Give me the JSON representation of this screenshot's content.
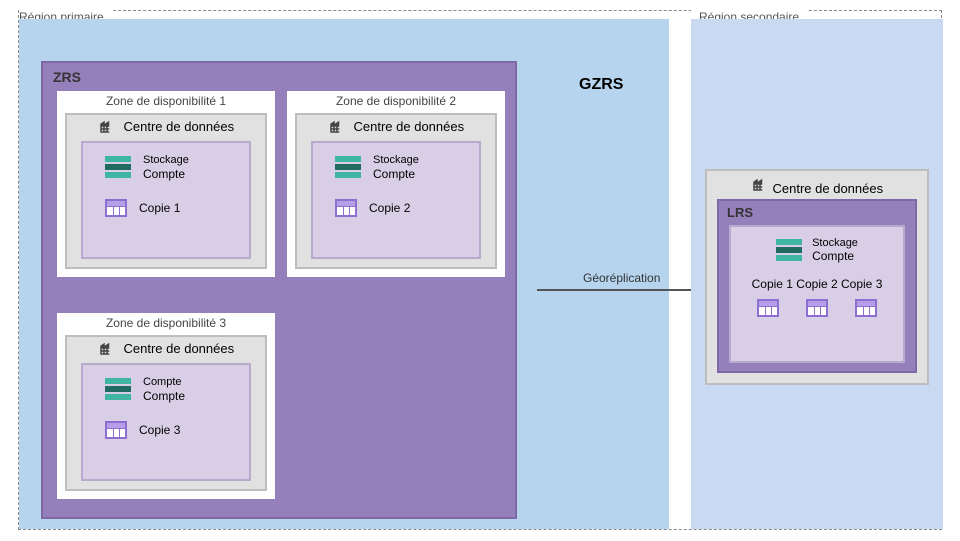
{
  "headers": {
    "primary": "Région primaire",
    "secondary": "Région secondaire",
    "gzrs": "GZRS",
    "zrs": "ZRS",
    "lrs": "LRS"
  },
  "labels": {
    "datacenter": "Centre de données",
    "storage_l1": "Stockage",
    "storage_l2": "Compte",
    "storage_l1_alt": "Compte",
    "georeplication": "Géoréplication"
  },
  "zones": {
    "z1": {
      "title": "Zone de disponibilité 1",
      "copy": "Copie 1"
    },
    "z2": {
      "title": "Zone de disponibilité 2",
      "copy": "Copie 2"
    },
    "z3": {
      "title": "Zone de disponibilité 3",
      "copy": "Copie 3"
    }
  },
  "secondary": {
    "copies_text": "Copie 1 Copie 2 Copie 3"
  }
}
